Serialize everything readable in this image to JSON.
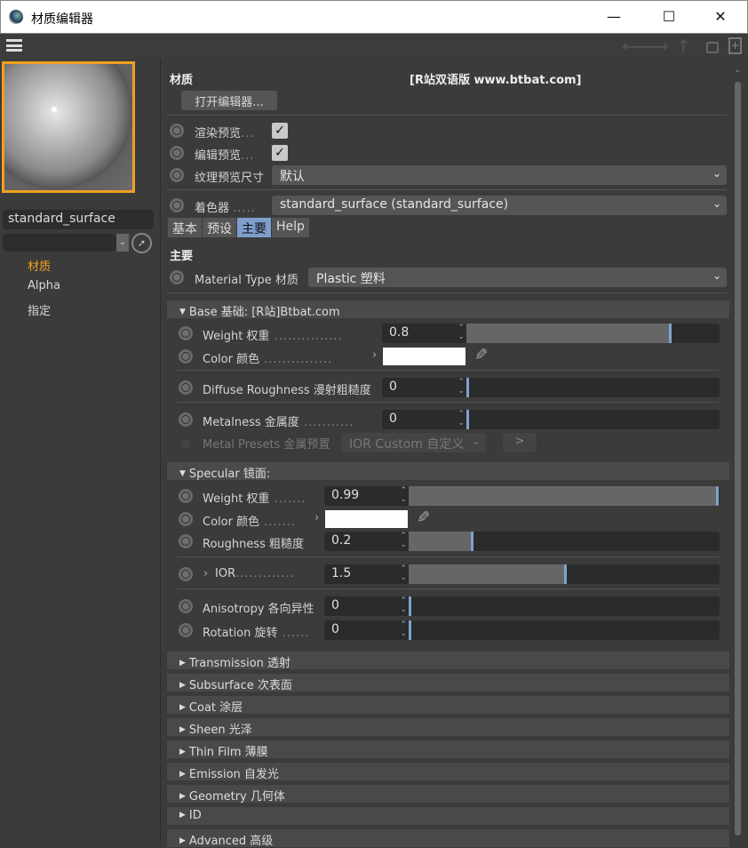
{
  "window": {
    "title": "材质编辑器",
    "minimize": "—",
    "maximize": "☐",
    "close": "✕"
  },
  "toolbar": {
    "menu_icon": "hamburger-icon",
    "back": "⟵",
    "forward": "⟶",
    "up": "↑",
    "lock": "lock-icon",
    "new": "new-panel-icon"
  },
  "left": {
    "material_name": "standard_surface",
    "filter_value": "",
    "nav": [
      {
        "label": "材质",
        "active": true
      },
      {
        "label": "Alpha"
      },
      {
        "label": "指定"
      }
    ],
    "accent": "#f0a020"
  },
  "header": {
    "section": "材质",
    "watermark": "[R站双语版 www.btbat.com]",
    "open_editor": "打开编辑器..."
  },
  "preview_opts": {
    "render_preview": "渲染预览",
    "render_checked": true,
    "edit_preview": "编辑预览",
    "edit_checked": true,
    "texture_size_label": "纹理预览尺寸",
    "texture_size_value": "默认",
    "shader_label": "着色器",
    "shader_value": "standard_surface (standard_surface)"
  },
  "tabs": [
    {
      "label": "基本"
    },
    {
      "label": "预设"
    },
    {
      "label": "主要",
      "active": true
    },
    {
      "label": "Help"
    }
  ],
  "main": {
    "title": "主要",
    "material_type_label": "Material Type 材质",
    "material_type_value": "Plastic 塑料"
  },
  "base": {
    "title": "Base 基础:  [R站]Btbat.com",
    "weight": {
      "label": "Weight 权重",
      "value": "0.8",
      "fill": 0.8
    },
    "color": {
      "label": "Color 颜色",
      "value": "#ffffff"
    },
    "diffuse_roughness": {
      "label": "Diffuse Roughness 漫射粗糙度",
      "value": "0",
      "fill": 0
    },
    "metalness": {
      "label": "Metalness 金属度",
      "value": "0",
      "fill": 0
    },
    "metal_presets": {
      "label": "Metal Presets 金属预置",
      "value": "IOR Custom 自定义",
      "button": ">"
    }
  },
  "specular": {
    "title": "Specular 镜面:",
    "weight": {
      "label": "Weight 权重",
      "value": "0.99",
      "fill": 0.99
    },
    "color": {
      "label": "Color 颜色",
      "value": "#ffffff"
    },
    "roughness": {
      "label": "Roughness 粗糙度",
      "value": "0.2",
      "fill": 0.2
    },
    "ior": {
      "label": "IOR",
      "value": "1.5",
      "fill": 0.5
    },
    "anisotropy": {
      "label": "Anisotropy 各向异性",
      "value": "0",
      "fill": 0
    },
    "rotation": {
      "label": "Rotation 旋转",
      "value": "0",
      "fill": 0
    }
  },
  "collapsed_sections": [
    "Transmission 透射",
    "Subsurface 次表面",
    "Coat 涂层",
    "Sheen 光泽",
    "Thin Film 薄膜",
    "Emission 自发光",
    "Geometry 几何体",
    "ID",
    "Advanced 高级"
  ]
}
